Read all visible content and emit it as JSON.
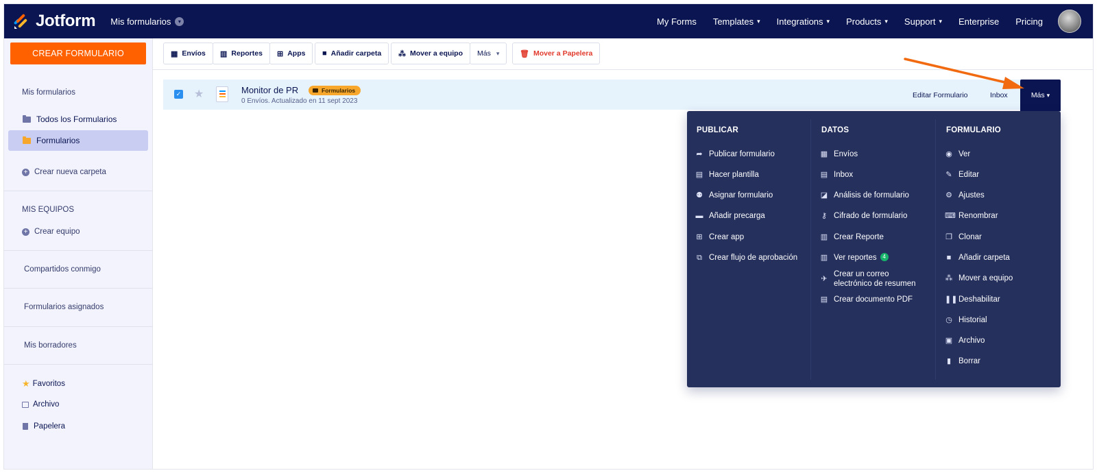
{
  "navbar": {
    "brand": "Jotform",
    "breadcrumb": "Mis formularios",
    "links": [
      {
        "label": "My Forms",
        "dropdown": false
      },
      {
        "label": "Templates",
        "dropdown": true
      },
      {
        "label": "Integrations",
        "dropdown": true
      },
      {
        "label": "Products",
        "dropdown": true
      },
      {
        "label": "Support",
        "dropdown": true
      },
      {
        "label": "Enterprise",
        "dropdown": false
      },
      {
        "label": "Pricing",
        "dropdown": false
      }
    ]
  },
  "sidebar": {
    "create_button": "CREAR FORMULARIO",
    "section_my_forms": "Mis formularios",
    "all_forms": "Todos los Formularios",
    "forms_folder": "Formularios",
    "new_folder": "Crear nueva carpeta",
    "section_teams": "MIS EQUIPOS",
    "create_team": "Crear equipo",
    "shared": "Compartidos conmigo",
    "assigned": "Formularios asignados",
    "drafts": "Mis borradores",
    "favorites": "Favoritos",
    "archive": "Archivo",
    "trash": "Papelera"
  },
  "toolbar": {
    "submissions": "Envíos",
    "reports": "Reportes",
    "apps": "Apps",
    "add_folder": "Añadir carpeta",
    "move_team": "Mover a equipo",
    "more": "Más",
    "trash": "Mover a Papelera"
  },
  "form": {
    "title": "Monitor de PR",
    "tag": "Formularios",
    "subtitle": "0 Envíos. Actualizado en 11 sept 2023",
    "edit_link": "Editar Formulario",
    "inbox_link": "Inbox",
    "more_button": "Más"
  },
  "dropdown": {
    "publicar": {
      "heading": "PUBLICAR",
      "items": [
        "Publicar formulario",
        "Hacer plantilla",
        "Asignar formulario",
        "Añadir precarga",
        "Crear app",
        "Crear flujo de aprobación"
      ]
    },
    "datos": {
      "heading": "DATOS",
      "items": [
        "Envíos",
        "Inbox",
        "Análisis de formulario",
        "Cifrado de formulario",
        "Crear Reporte",
        "Ver reportes",
        "Crear un correo",
        "electrónico de resumen",
        "Crear documento PDF"
      ],
      "reports_badge": "4"
    },
    "formulario": {
      "heading": "FORMULARIO",
      "items": [
        "Ver",
        "Editar",
        "Ajustes",
        "Renombrar",
        "Clonar",
        "Añadir carpeta",
        "Mover a equipo",
        "Deshabilitar",
        "Historial",
        "Archivo",
        "Borrar"
      ]
    }
  },
  "colors": {
    "navy": "#0a1551",
    "orange": "#ff6100",
    "menu_bg": "#25305d",
    "row_bg": "#e6f3fd",
    "sidebar_bg": "#f3f3fe",
    "tag": "#f7a82c",
    "badge": "#18b36b",
    "arrow": "#f26a0f"
  }
}
